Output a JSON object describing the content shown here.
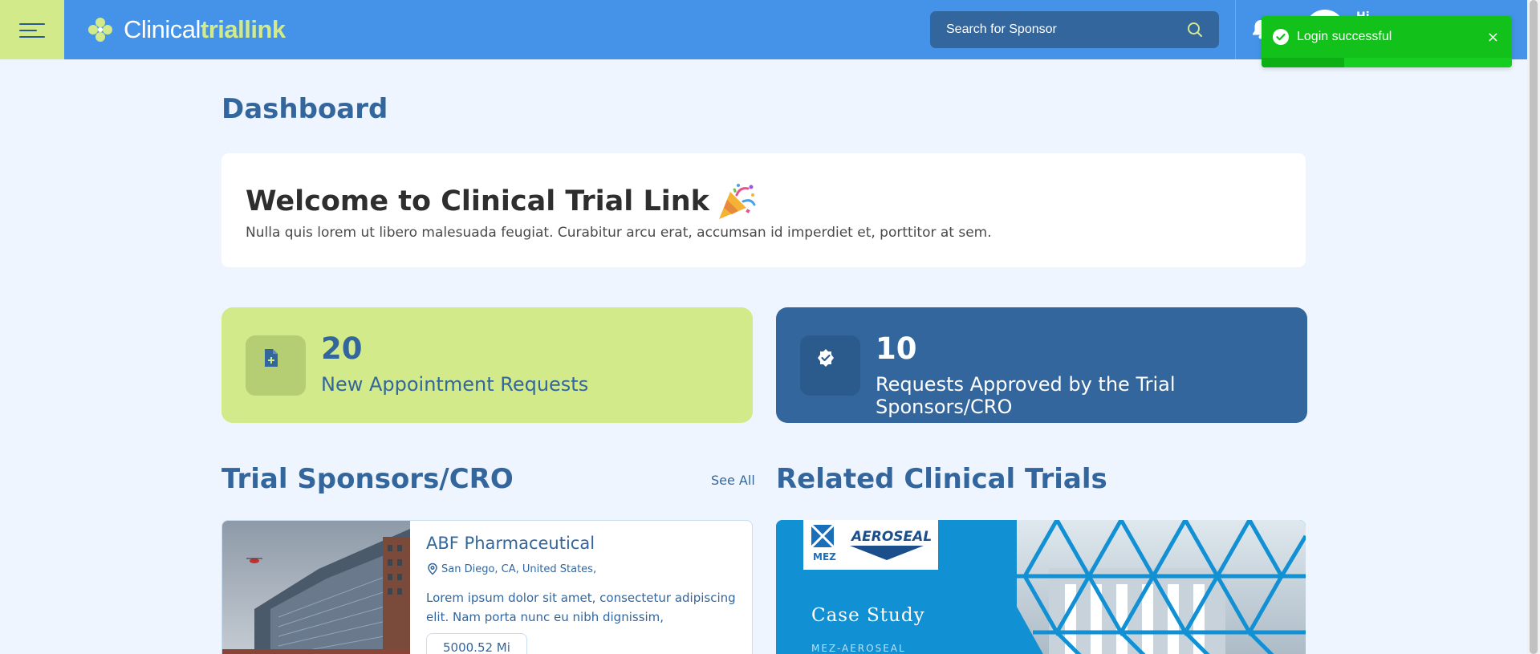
{
  "header": {
    "logo_part1": "Clinical",
    "logo_part2": "triallink",
    "search_placeholder": "Search for Sponsor",
    "greeting": "Hi"
  },
  "toast": {
    "message": "Login successful",
    "close": "×"
  },
  "page": {
    "title": "Dashboard"
  },
  "welcome": {
    "title": "Welcome to Clinical Trial Link",
    "text": "Nulla quis lorem ut libero malesuada feugiat. Curabitur arcu erat, accumsan id imperdiet et, porttitor at sem."
  },
  "stats": [
    {
      "value": "20",
      "label": "New Appointment Requests",
      "icon": "document-plus-icon"
    },
    {
      "value": "10",
      "label": "Requests Approved by the Trial Sponsors/CRO",
      "icon": "check-badge-icon"
    }
  ],
  "sponsors_section": {
    "title": "Trial Sponsors/CRO",
    "see_all": "See All",
    "card": {
      "name": "ABF Pharmaceutical",
      "location": "San Diego, CA, United States,",
      "description": "Lorem ipsum dolor sit amet, consectetur adipiscing elit. Nam porta nunc eu nibh dignissim,",
      "distance": "5000.52 Mi"
    }
  },
  "trials_section": {
    "title": "Related Clinical Trials",
    "card": {
      "brand": "AEROSEAL",
      "brand_mark": "MEZ",
      "heading": "Case Study",
      "subheading": "MEZ-AEROSEAL"
    }
  },
  "colors": {
    "topbar": "#4493e8",
    "accent_green": "#d3ea8b",
    "primary_blue": "#33669d",
    "toast_green": "#12c11a"
  }
}
